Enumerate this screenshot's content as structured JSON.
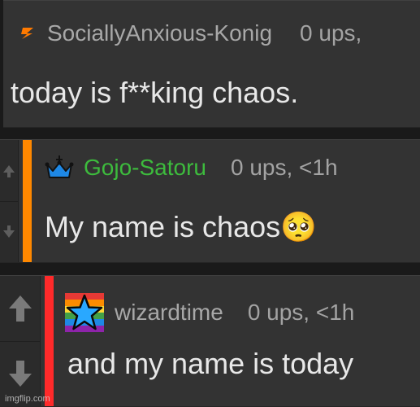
{
  "comments": [
    {
      "username": "SociallyAnxious-Konig",
      "ups": "0 ups,",
      "body": "today is f**king chaos.",
      "badge_icon": "lightning-bolt-icon",
      "accent": "#ff7a00"
    },
    {
      "username": "Gojo-Satoru",
      "ups": "0 ups, <1h",
      "body": "My name is chaos",
      "badge_icon": "crown-icon",
      "emoji": "🥺",
      "accent": "#ff8800",
      "username_color": "#3dbb3d"
    },
    {
      "username": "wizardtime",
      "ups": "0 ups, <1h",
      "body": "and my name is today",
      "badge_icon": "rainbow-star-icon",
      "accent": "#ff2a2a"
    }
  ],
  "watermark": "imgflip.com"
}
